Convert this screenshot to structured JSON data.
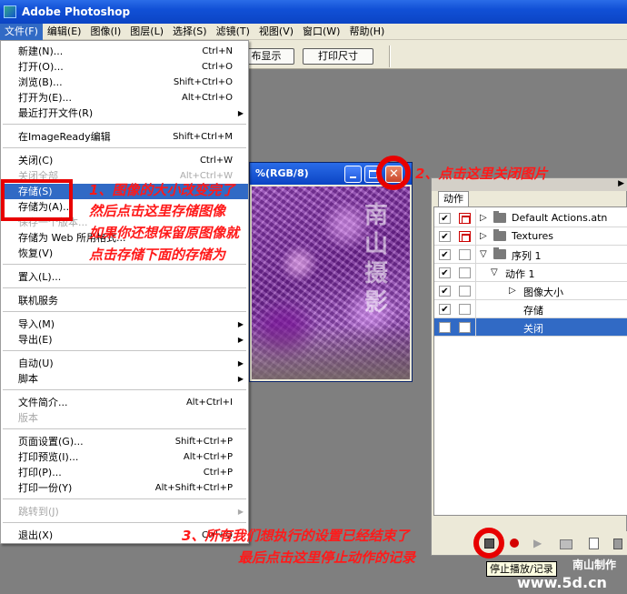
{
  "app": {
    "title": "Adobe Photoshop"
  },
  "menubar": [
    "文件(F)",
    "编辑(E)",
    "图像(I)",
    "图层(L)",
    "选择(S)",
    "滤镜(T)",
    "视图(V)",
    "窗口(W)",
    "帮助(H)"
  ],
  "options_bar": {
    "btn_print_fit": "布显示",
    "btn_print_size": "打印尺寸"
  },
  "file_menu": {
    "items": [
      {
        "label": "新建(N)...",
        "shortcut": "Ctrl+N"
      },
      {
        "label": "打开(O)...",
        "shortcut": "Ctrl+O"
      },
      {
        "label": "浏览(B)...",
        "shortcut": "Shift+Ctrl+O"
      },
      {
        "label": "打开为(E)...",
        "shortcut": "Alt+Ctrl+O"
      },
      {
        "label": "最近打开文件(R)",
        "shortcut": ""
      },
      {
        "label": "在ImageReady编辑",
        "shortcut": "Shift+Ctrl+M"
      },
      {
        "label": "关闭(C)",
        "shortcut": "Ctrl+W"
      },
      {
        "label": "关闭全部",
        "shortcut": "Alt+Ctrl+W"
      },
      {
        "label": "存储(S)",
        "shortcut": ""
      },
      {
        "label": "存储为(A)...",
        "shortcut": ""
      },
      {
        "label": "保存一个版本...",
        "shortcut": ""
      },
      {
        "label": "存储为 Web 所用格式...",
        "shortcut": ""
      },
      {
        "label": "恢复(V)",
        "shortcut": ""
      },
      {
        "label": "置入(L)...",
        "shortcut": ""
      },
      {
        "label": "联机服务",
        "shortcut": ""
      },
      {
        "label": "导入(M)",
        "shortcut": ""
      },
      {
        "label": "导出(E)",
        "shortcut": ""
      },
      {
        "label": "自动(U)",
        "shortcut": ""
      },
      {
        "label": "脚本",
        "shortcut": ""
      },
      {
        "label": "文件简介...",
        "shortcut": "Alt+Ctrl+I"
      },
      {
        "label": "版本",
        "shortcut": ""
      },
      {
        "label": "页面设置(G)...",
        "shortcut": "Shift+Ctrl+P"
      },
      {
        "label": "打印预览(I)...",
        "shortcut": "Alt+Ctrl+P"
      },
      {
        "label": "打印(P)...",
        "shortcut": "Ctrl+P"
      },
      {
        "label": "打印一份(Y)",
        "shortcut": "Alt+Shift+Ctrl+P"
      },
      {
        "label": "跳转到(J)",
        "shortcut": ""
      },
      {
        "label": "退出(X)",
        "shortcut": "Ctrl+Q"
      }
    ]
  },
  "document": {
    "title": "%(RGB/8)",
    "watermark": "南山摄影"
  },
  "actions_panel": {
    "tab": "动作",
    "rows": [
      {
        "label": "Default Actions.atn"
      },
      {
        "label": "Textures"
      },
      {
        "label": "序列 1"
      },
      {
        "label": "动作 1"
      },
      {
        "label": "图像大小"
      },
      {
        "label": "存储"
      },
      {
        "label": "关闭"
      }
    ]
  },
  "tooltip": "停止播放/记录",
  "annotations": {
    "note1_line1": "1、图像的大小改变完了",
    "note1_line2": "然后点击这里存储图像",
    "note1_line3": "如果你还想保留原图像就",
    "note1_line4": "点击存储下面的存储为",
    "note2": "2、点击这里关闭图片",
    "note3_line1": "3、所有我们想执行的设置已经结束了",
    "note3_line2": "最后点击这里停止动作的记录"
  },
  "site": {
    "credit": "南山制作",
    "url": "www.5d.cn"
  },
  "colors": {
    "annotation": "#ff1a1a",
    "highlight": "#316ac5",
    "titlebar": "#1150d6"
  }
}
